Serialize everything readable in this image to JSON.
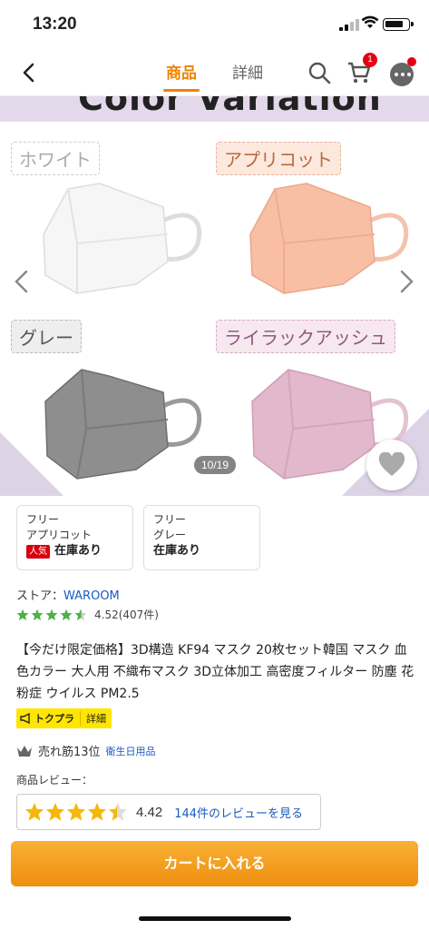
{
  "status_bar": {
    "time": "13:20"
  },
  "nav": {
    "tabs": [
      {
        "label": "商品",
        "active": true
      },
      {
        "label": "詳細",
        "active": false
      }
    ],
    "cart_count": "1",
    "accent": "#f08300"
  },
  "gallery": {
    "banner_text": "Color Variation",
    "labels": {
      "white": "ホワイト",
      "apricot": "アプリコット",
      "gray": "グレー",
      "lilac": "ライラックアッシュ"
    },
    "counter": "10/19"
  },
  "variants": [
    {
      "size": "フリー",
      "color": "アプリコット",
      "badge": "人気",
      "stock": "在庫あり"
    },
    {
      "size": "フリー",
      "color": "グレー",
      "badge": "",
      "stock": "在庫あり"
    }
  ],
  "store": {
    "label": "ストア：",
    "name": "WAROOM"
  },
  "store_rating": {
    "value": 4.52,
    "text": "4.52(407件)"
  },
  "product_title": "【今だけ限定価格】3D構造 KF94 マスク 20枚セット韓国 マスク 血色カラー 大人用 不織布マスク 3D立体加工 高密度フィルター 防塵 花粉症 ウイルス PM2.5",
  "tokupura": {
    "label": "トクプラ",
    "detail": "詳細"
  },
  "ranking": {
    "text": "売れ筋13位",
    "category": "衛生日用品"
  },
  "reviews": {
    "label": "商品レビュー：",
    "score": "4.42",
    "link": "144件のレビューを見る"
  },
  "cart_button": "カートに入れる"
}
